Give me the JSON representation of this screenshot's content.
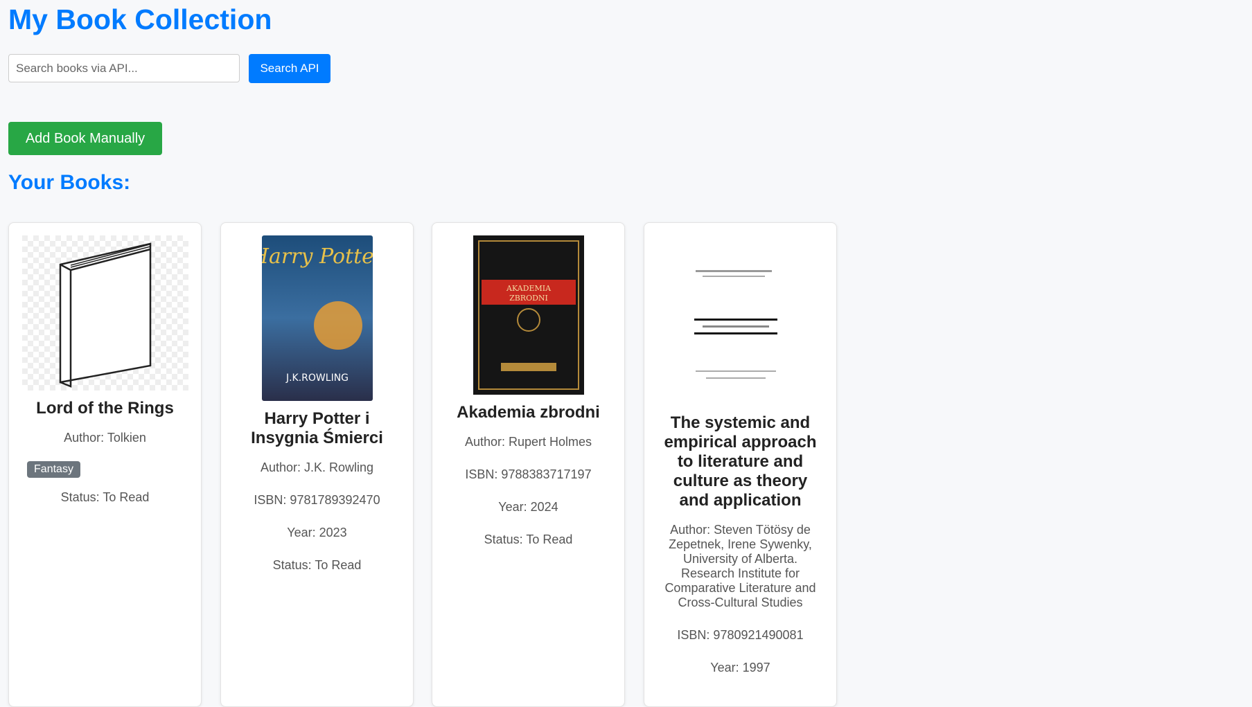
{
  "header": {
    "title": "My Book Collection"
  },
  "search": {
    "placeholder": "Search books via API...",
    "button": "Search API"
  },
  "add_button": "Add Book Manually",
  "section_title": "Your Books:",
  "books": [
    {
      "title": "Lord of the Rings",
      "author": "Author: Tolkien",
      "genre": "Fantasy",
      "status": "Status: To Read"
    },
    {
      "title": "Harry Potter i Insygnia Śmierci",
      "author": "Author: J.K. Rowling",
      "isbn": "ISBN: 9781789392470",
      "year": "Year: 2023",
      "status": "Status: To Read"
    },
    {
      "title": "Akademia zbrodni",
      "author": "Author: Rupert Holmes",
      "isbn": "ISBN: 9788383717197",
      "year": "Year: 2024",
      "status": "Status: To Read"
    },
    {
      "title": "The systemic and empirical approach to literature and culture as theory and application",
      "author": "Author: Steven Tötösy de Zepetnek, Irene Sywenky, University of Alberta. Research Institute for Comparative Literature and Cross-Cultural Studies",
      "isbn": "ISBN: 9780921490081",
      "year": "Year: 1997"
    }
  ]
}
